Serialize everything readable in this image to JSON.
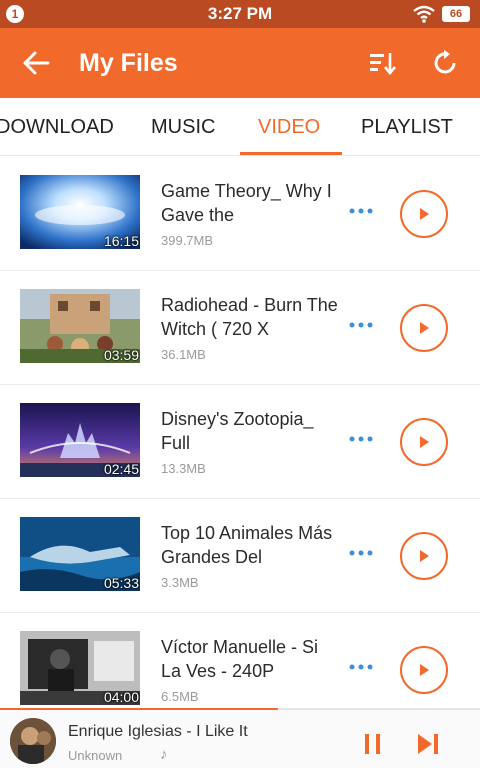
{
  "status_bar": {
    "notification_count": "1",
    "time": "3:27 PM",
    "battery": "66",
    "icons": [
      "notification-icon",
      "wifi-icon",
      "battery-icon"
    ]
  },
  "app_bar": {
    "title": "My Files",
    "icons": [
      "back-arrow-icon",
      "sort-icon",
      "refresh-icon"
    ]
  },
  "tabs": [
    {
      "label": "DOWNLOAD",
      "active": false
    },
    {
      "label": "MUSIC",
      "active": false
    },
    {
      "label": "VIDEO",
      "active": true
    },
    {
      "label": "PLAYLIST",
      "active": false
    }
  ],
  "videos": [
    {
      "title": "Game Theory_ Why I Gave the",
      "size": "399.7MB",
      "duration": "16:15"
    },
    {
      "title": "Radiohead - Burn The Witch ( 720 X",
      "size": "36.1MB",
      "duration": "03:59"
    },
    {
      "title": "Disney's Zootopia_ Full",
      "size": "13.3MB",
      "duration": "02:45"
    },
    {
      "title": "Top 10 Animales Más Grandes Del",
      "size": "3.3MB",
      "duration": "05:33"
    },
    {
      "title": "Víctor Manuelle - Si La Ves - 240P",
      "size": "6.5MB",
      "duration": "04:00"
    }
  ],
  "now_playing": {
    "song": "Enrique Iglesias - I Like It",
    "artist": "Unknown",
    "note_symbol": "♪",
    "progress": 0.58,
    "icons": [
      "pause-icon",
      "skip-next-icon"
    ]
  },
  "colors": {
    "accent": "#f26a2b",
    "status_bar": "#b94a22",
    "more_dots": "#3d8ed8"
  }
}
